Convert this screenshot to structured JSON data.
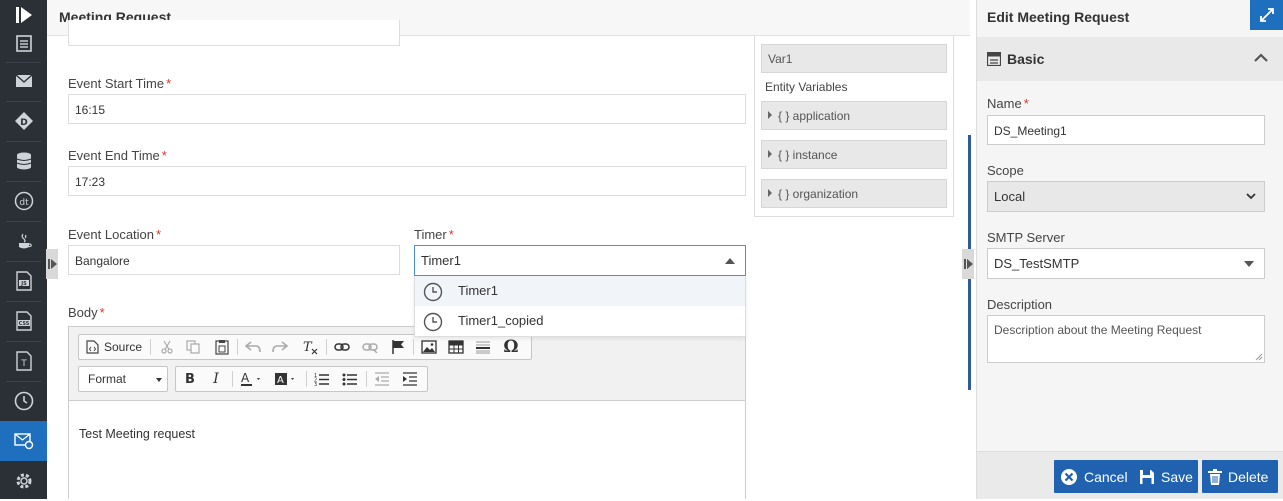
{
  "sidebar": {
    "items": [
      "logo-icon",
      "document-icon",
      "mail-icon",
      "decision-icon",
      "database-icon",
      "dt-icon",
      "java-icon",
      "js-file-icon",
      "css-file-icon",
      "text-file-icon",
      "clock-icon",
      "mail-settings-icon",
      "settings-icon"
    ]
  },
  "main": {
    "header_title": "Meeting Request",
    "fields": {
      "start_time_label": "Event Start Time",
      "start_time_value": "16:15",
      "end_time_label": "Event End Time",
      "end_time_value": "17:23",
      "location_label": "Event Location",
      "location_value": "Bangalore",
      "timer_label": "Timer",
      "timer_value": "Timer1",
      "body_label": "Body",
      "required_mark": "*"
    },
    "timer_options": [
      "Timer1",
      "Timer1_copied"
    ],
    "editor": {
      "source_label": "Source",
      "format_label": "Format",
      "body_text": "Test Meeting request"
    },
    "variables": {
      "var1": "Var1",
      "entity_label": "Entity Variables",
      "entities": [
        "{ } application",
        "{ } instance",
        "{ } organization"
      ]
    }
  },
  "right_panel": {
    "header_title": "Edit Meeting Request",
    "section_title": "Basic",
    "name_label": "Name",
    "name_value": "DS_Meeting1",
    "scope_label": "Scope",
    "scope_value": "Local",
    "smtp_label": "SMTP Server",
    "smtp_value": "DS_TestSMTP",
    "description_label": "Description",
    "description_placeholder": "Description about the Meeting Request",
    "buttons": {
      "cancel": "Cancel",
      "save": "Save",
      "delete": "Delete"
    }
  },
  "colors": {
    "accent": "#1f6fbf",
    "sidebar_bg": "#2b2f36",
    "required": "#d9342b"
  }
}
